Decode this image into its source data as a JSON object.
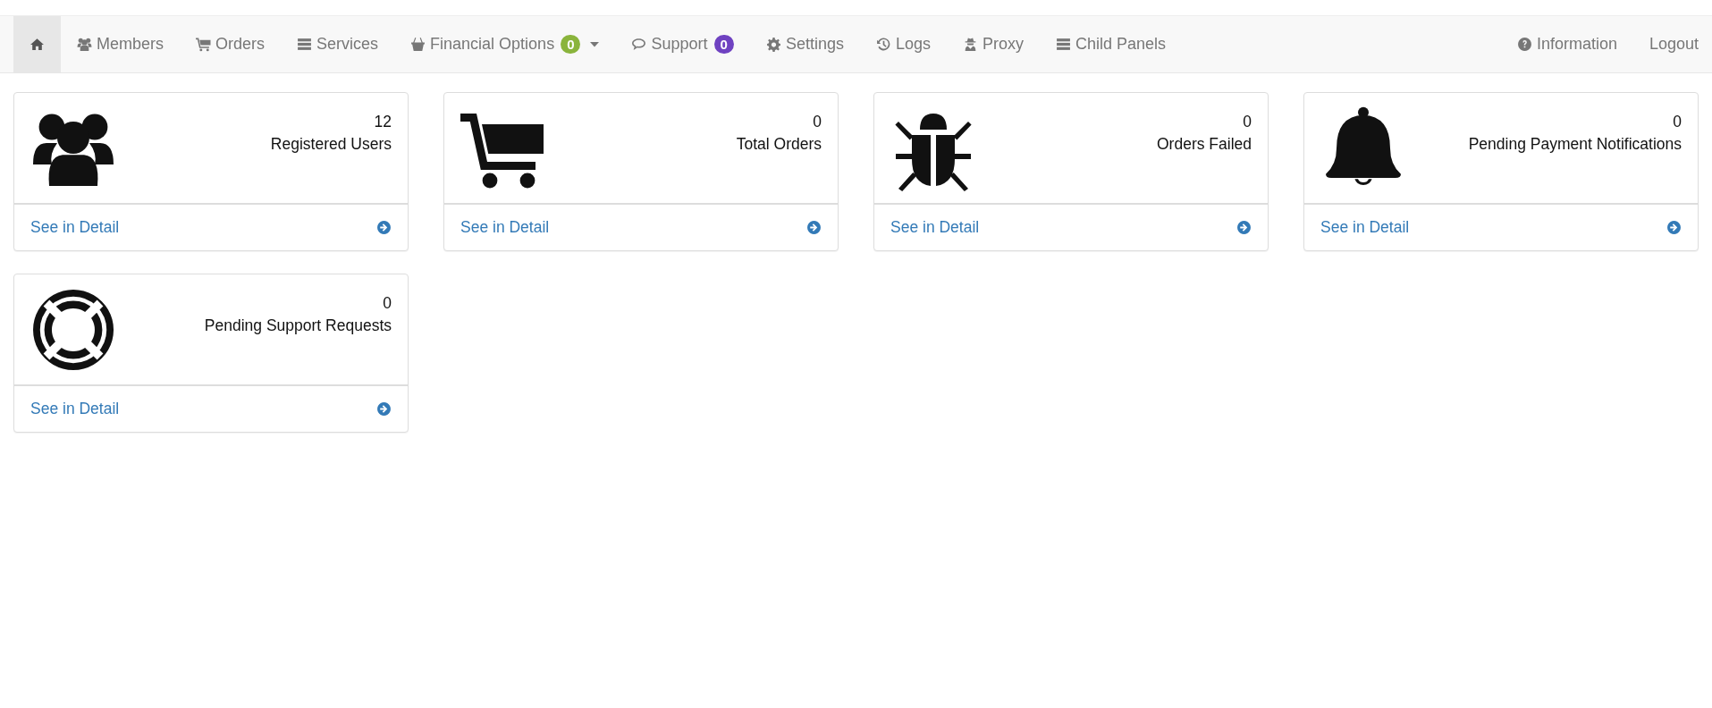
{
  "navbar": {
    "items": [
      {
        "selected": true
      },
      {
        "label": "Members",
        "selected": false
      },
      {
        "label": "Orders",
        "selected": false
      },
      {
        "label": "Services",
        "selected": false
      },
      {
        "label": "Financial Options",
        "selected": false,
        "badge": "0",
        "color": "#8ab43c",
        "dropdown": true
      },
      {
        "label": "Support",
        "selected": false,
        "badge": "0",
        "color": "#6f42c1"
      },
      {
        "label": "Settings",
        "selected": false
      },
      {
        "label": "Logs",
        "selected": false
      },
      {
        "label": "Proxy",
        "selected": false
      },
      {
        "label": "Child Panels",
        "selected": false
      }
    ],
    "right_items": [
      {
        "label": "Information"
      },
      {
        "label": "Logout"
      }
    ]
  },
  "cards": [
    {
      "count": "12",
      "label": "Registered Users",
      "link": "See in Detail"
    },
    {
      "count": "0",
      "label": "Total Orders",
      "link": "See in Detail"
    },
    {
      "count": "0",
      "label": "Orders Failed",
      "link": "See in Detail"
    },
    {
      "count": "0",
      "label": "Pending Payment Notifications",
      "link": "See in Detail"
    },
    {
      "count": "0",
      "label": "Pending Support Requests",
      "link": "See in Detail"
    }
  ]
}
